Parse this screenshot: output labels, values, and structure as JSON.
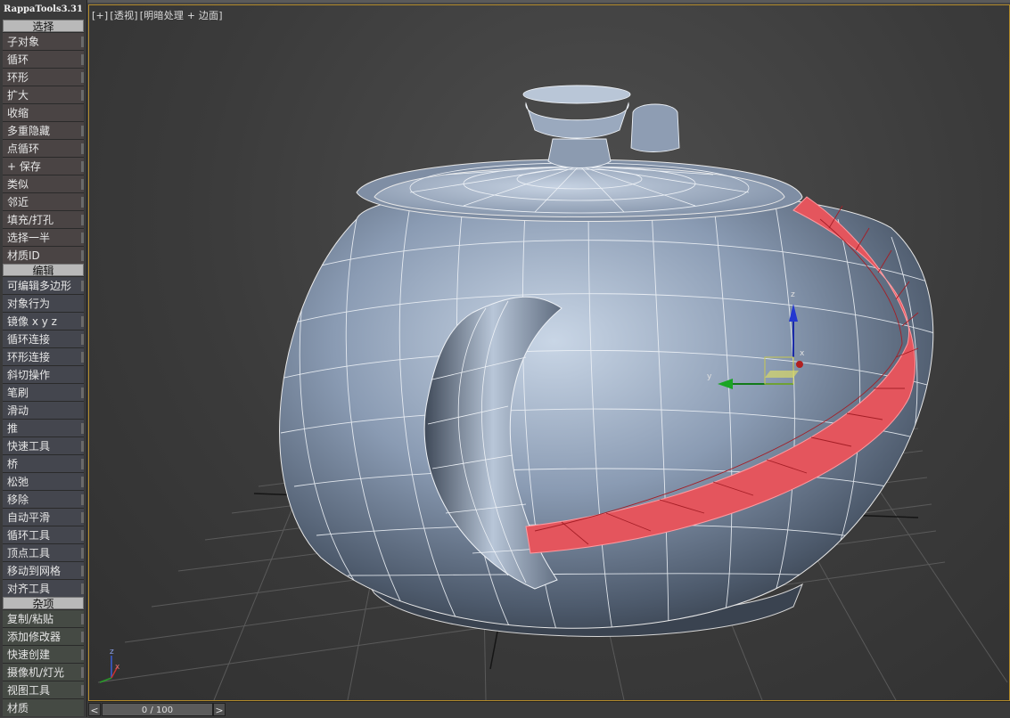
{
  "panel": {
    "title": "RappaTools3.31",
    "sections": {
      "select": "选择",
      "edit": "编辑",
      "misc": "杂项"
    },
    "select_items": [
      "子对象",
      "循环",
      "环形",
      "扩大",
      "收缩",
      "多重隐藏",
      "点循环",
      "+ 保存",
      "类似",
      "邻近",
      "填充/打孔",
      "选择一半",
      "材质ID"
    ],
    "edit_items": [
      "可编辑多边形",
      "对象行为",
      "镜像  x  y  z",
      "循环连接",
      "环形连接",
      "斜切操作",
      "笔刷",
      "滑动",
      "推",
      "快速工具",
      "桥",
      "松弛",
      "移除",
      "自动平滑",
      "循环工具",
      "顶点工具",
      "移动到网格",
      "对齐工具"
    ],
    "misc_items": [
      "复制/粘贴",
      "添加修改器",
      "快速创建",
      "摄像机/灯光",
      "视图工具",
      "材质"
    ]
  },
  "viewport": {
    "label_plus": "[+]",
    "label_view": "[透视]",
    "label_shading": "[明暗处理 + 边面]",
    "gizmo": {
      "z": "z",
      "y": "y",
      "x": "x"
    },
    "axis_tripod": {
      "z": "z",
      "x": "x"
    }
  },
  "timeline": {
    "prev": "<",
    "next": ">",
    "frame": "0 / 100"
  },
  "colors": {
    "selection_red": "#e2505a",
    "mesh_blue": "#8797ac",
    "frame_border": "#b28a2a"
  }
}
